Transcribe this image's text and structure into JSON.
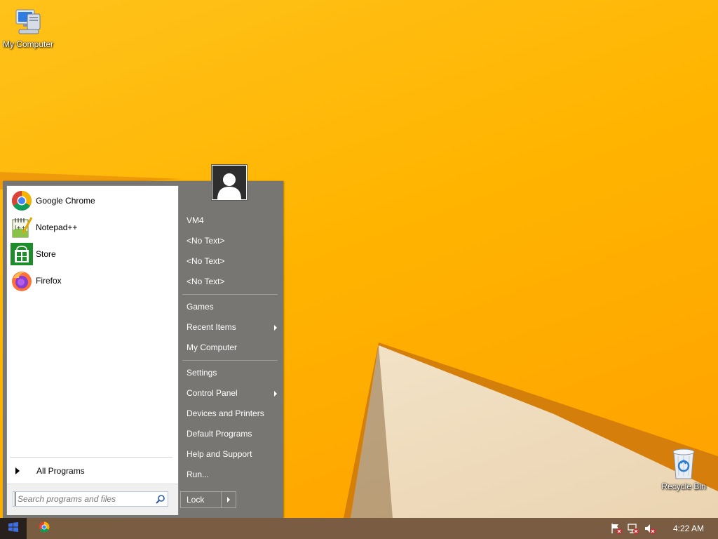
{
  "desktop": {
    "icons": [
      {
        "label": "My Computer",
        "icon": "computer-icon"
      },
      {
        "label": "Recycle Bin",
        "icon": "recycle-bin-icon"
      }
    ]
  },
  "start_menu": {
    "pinned_programs": [
      {
        "label": "Google Chrome",
        "icon": "chrome-icon"
      },
      {
        "label": "Notepad++",
        "icon": "notepad-plus-plus-icon"
      },
      {
        "label": "Store",
        "icon": "store-icon"
      },
      {
        "label": "Firefox",
        "icon": "firefox-icon"
      }
    ],
    "all_programs_label": "All Programs",
    "search_placeholder": "Search programs and files",
    "user_avatar_icon": "user-avatar-icon",
    "right_items": [
      {
        "label": "VM4",
        "submenu": false
      },
      {
        "label": "<No Text>",
        "submenu": false
      },
      {
        "label": "<No Text>",
        "submenu": false
      },
      {
        "label": "<No Text>",
        "submenu": false
      },
      {
        "label": "Games",
        "submenu": false
      },
      {
        "label": "Recent Items",
        "submenu": true
      },
      {
        "label": "My Computer",
        "submenu": false
      },
      {
        "label": "Settings",
        "submenu": false
      },
      {
        "label": "Control Panel",
        "submenu": true
      },
      {
        "label": "Devices and Printers",
        "submenu": false
      },
      {
        "label": "Default Programs",
        "submenu": false
      },
      {
        "label": "Help and Support",
        "submenu": false
      },
      {
        "label": "Run...",
        "submenu": false
      }
    ],
    "lock_label": "Lock"
  },
  "taskbar": {
    "start_icon": "windows-logo-icon",
    "pinned": [
      {
        "icon": "chrome-icon"
      }
    ],
    "tray_icons": [
      "action-center-flag-icon",
      "network-icon",
      "volume-muted-icon"
    ],
    "clock": "4:22 AM"
  },
  "colors": {
    "wallpaper": "#ffb400",
    "menu_right_pane": "#787672",
    "taskbar": "#6e5646",
    "start_button": "#27201c"
  }
}
